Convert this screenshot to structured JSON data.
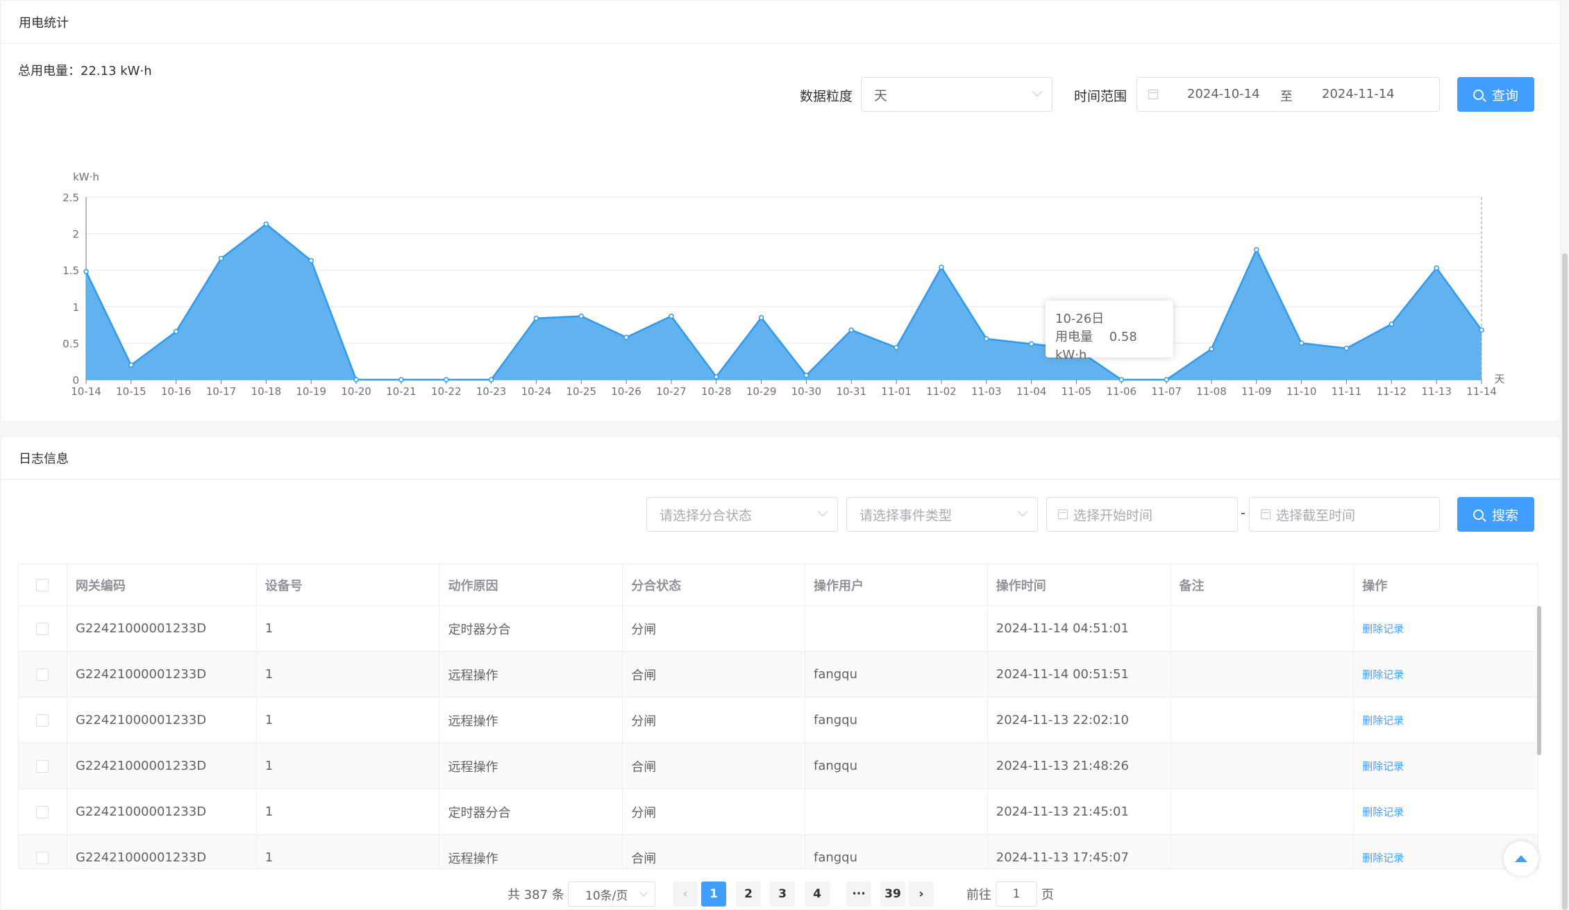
{
  "stats": {
    "title": "用电统计",
    "total": "总用电量：22.13 kW·h",
    "granularity_label": "数据粒度",
    "granularity_value": "天",
    "range_label": "时间范围",
    "range_start": "2024-10-14",
    "range_sep": "至",
    "range_end": "2024-11-14",
    "query_button": "查询"
  },
  "tooltip": {
    "title": "10-26日",
    "series": "用电量",
    "value": "0.58 kW·h"
  },
  "chart_data": {
    "type": "area",
    "ylabel": "kW·h",
    "xlabel": "天",
    "ylim": [
      0,
      2.5
    ],
    "yticks": [
      "0",
      "0.5",
      "1",
      "1.5",
      "2",
      "2.5"
    ],
    "categories": [
      "10-14",
      "10-15",
      "10-16",
      "10-17",
      "10-18",
      "10-19",
      "10-20",
      "10-21",
      "10-22",
      "10-23",
      "10-24",
      "10-25",
      "10-26",
      "10-27",
      "10-28",
      "10-29",
      "10-30",
      "10-31",
      "11-01",
      "11-02",
      "11-03",
      "11-04",
      "11-05",
      "11-06",
      "11-07",
      "11-08",
      "11-09",
      "11-10",
      "11-11",
      "11-12",
      "11-13",
      "11-14"
    ],
    "series": [
      {
        "values": [
          1.48,
          0.2,
          0.66,
          1.66,
          2.13,
          1.63,
          0.0,
          0.0,
          0.0,
          0.0,
          0.84,
          0.87,
          0.58,
          0.87,
          0.04,
          0.85,
          0.06,
          0.68,
          0.44,
          1.54,
          0.56,
          0.49,
          0.42,
          0.0,
          0.0,
          0.42,
          1.78,
          0.5,
          0.43,
          0.76,
          1.53,
          0.68
        ],
        "color": "#2f9aef"
      }
    ],
    "grid": true,
    "tooltip_category": "10-26"
  },
  "logs": {
    "title": "日志信息",
    "status_placeholder": "请选择分合状态",
    "event_placeholder": "请选择事件类型",
    "start_placeholder": "选择开始时间",
    "range_dash": "-",
    "end_placeholder": "选择截至时间",
    "search_button": "搜索",
    "columns": [
      "网关编码",
      "设备号",
      "动作原因",
      "分合状态",
      "操作用户",
      "操作时间",
      "备注",
      "操作"
    ],
    "rows": [
      {
        "gateway": "G22421000001233D",
        "device": "1",
        "reason": "定时器分合",
        "state": "分闸",
        "user": "",
        "time": "2024-11-14 04:51:01",
        "note": "",
        "action": "删除记录"
      },
      {
        "gateway": "G22421000001233D",
        "device": "1",
        "reason": "远程操作",
        "state": "合闸",
        "user": "fangqu",
        "time": "2024-11-14 00:51:51",
        "note": "",
        "action": "删除记录"
      },
      {
        "gateway": "G22421000001233D",
        "device": "1",
        "reason": "远程操作",
        "state": "分闸",
        "user": "fangqu",
        "time": "2024-11-13 22:02:10",
        "note": "",
        "action": "删除记录"
      },
      {
        "gateway": "G22421000001233D",
        "device": "1",
        "reason": "远程操作",
        "state": "合闸",
        "user": "fangqu",
        "time": "2024-11-13 21:48:26",
        "note": "",
        "action": "删除记录"
      },
      {
        "gateway": "G22421000001233D",
        "device": "1",
        "reason": "定时器分合",
        "state": "分闸",
        "user": "",
        "time": "2024-11-13 21:45:01",
        "note": "",
        "action": "删除记录"
      },
      {
        "gateway": "G22421000001233D",
        "device": "1",
        "reason": "远程操作",
        "state": "合闸",
        "user": "fangqu",
        "time": "2024-11-13 17:45:07",
        "note": "",
        "action": "删除记录"
      }
    ]
  },
  "pagination": {
    "total": "共 387 条",
    "page_size": "10条/页",
    "pages": [
      "1",
      "2",
      "3",
      "4",
      "···",
      "39"
    ],
    "current": "1",
    "goto_label": "前往",
    "goto_value": "1",
    "goto_suffix": "页"
  }
}
